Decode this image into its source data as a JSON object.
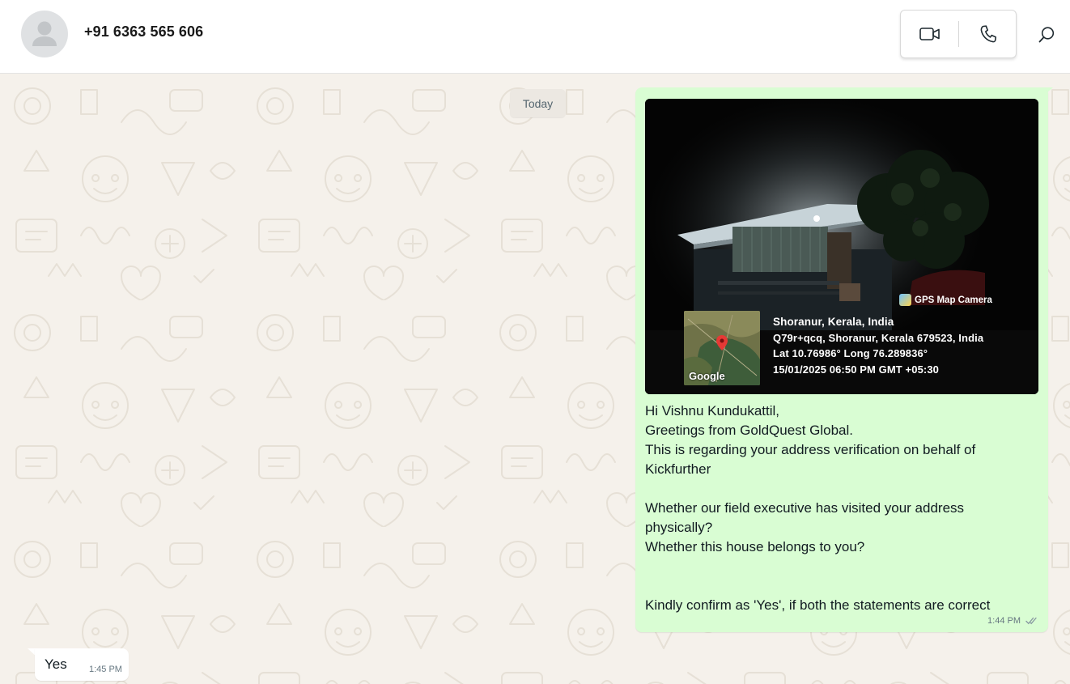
{
  "header": {
    "contact_name": "+91 6363 565 606",
    "video_call_icon": "video-camera-icon",
    "voice_call_icon": "phone-icon",
    "search_icon": "search-icon"
  },
  "chat": {
    "date_divider": "Today",
    "outgoing": {
      "photo": {
        "badge_label": "GPS Map Camera",
        "map_watermark": "Google",
        "location_title": "Shoranur, Kerala, India",
        "address": "Q79r+qcq, Shoranur, Kerala 679523, India",
        "coordinates": "Lat 10.76986° Long 76.289836°",
        "datetime": "15/01/2025 06:50 PM GMT +05:30"
      },
      "lines": [
        "Hi Vishnu Kundukattil,",
        "Greetings from GoldQuest Global.",
        "This is regarding your address verification on behalf of",
        "Kickfurther",
        "",
        "Whether our field executive has visited your address",
        "physically?",
        "Whether this house belongs to you?",
        "",
        "",
        "Kindly confirm as 'Yes', if both the statements are correct"
      ],
      "time": "1:44 PM",
      "status_icon": "double-check-icon"
    },
    "incoming": {
      "text": "Yes",
      "time": "1:45 PM"
    }
  },
  "colors": {
    "outgoing_bubble": "#d9fdd3",
    "incoming_bubble": "#ffffff",
    "wallpaper": "#f5f1eb",
    "meta_text": "#667781"
  }
}
